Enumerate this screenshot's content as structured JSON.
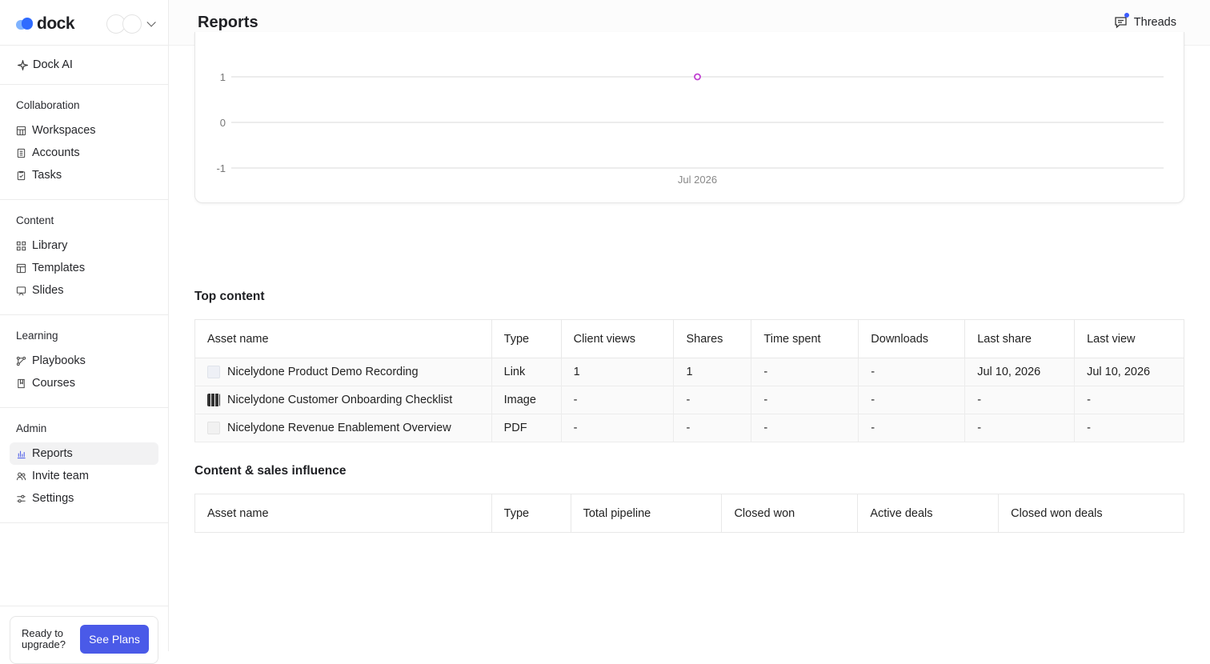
{
  "app": {
    "brand": "dock"
  },
  "header": {
    "title": "Reports",
    "threads_label": "Threads"
  },
  "sidebar": {
    "ai_label": "Dock AI",
    "sections": [
      {
        "title": "Collaboration",
        "items": [
          {
            "label": "Workspaces",
            "icon": "workspaces-icon"
          },
          {
            "label": "Accounts",
            "icon": "accounts-icon"
          },
          {
            "label": "Tasks",
            "icon": "tasks-icon"
          }
        ]
      },
      {
        "title": "Content",
        "items": [
          {
            "label": "Library",
            "icon": "library-icon"
          },
          {
            "label": "Templates",
            "icon": "templates-icon"
          },
          {
            "label": "Slides",
            "icon": "slides-icon"
          }
        ]
      },
      {
        "title": "Learning",
        "items": [
          {
            "label": "Playbooks",
            "icon": "playbooks-icon"
          },
          {
            "label": "Courses",
            "icon": "courses-icon"
          }
        ]
      },
      {
        "title": "Admin",
        "items": [
          {
            "label": "Reports",
            "icon": "reports-icon",
            "active": true
          },
          {
            "label": "Invite team",
            "icon": "invite-team-icon"
          },
          {
            "label": "Settings",
            "icon": "settings-icon"
          }
        ]
      }
    ],
    "upgrade": {
      "text": "Ready to upgrade?",
      "button": "See Plans"
    }
  },
  "chart_data": {
    "type": "line",
    "x": [
      "Jul 2026"
    ],
    "series": [
      {
        "values": [
          1
        ],
        "color": "#c03fd1"
      }
    ],
    "yticks": [
      "1",
      "0",
      "-1"
    ],
    "ylim": [
      -1,
      1
    ],
    "grid": true
  },
  "top_content": {
    "title": "Top content",
    "columns": [
      "Asset name",
      "Type",
      "Client views",
      "Shares",
      "Time spent",
      "Downloads",
      "Last share",
      "Last view"
    ],
    "rows": [
      {
        "thumb": "link",
        "name": "Nicelydone Product Demo Recording",
        "type": "Link",
        "client_views": "1",
        "shares": "1",
        "time_spent": "-",
        "downloads": "-",
        "last_share": "Jul 10, 2026",
        "last_view": "Jul 10, 2026"
      },
      {
        "thumb": "image",
        "name": "Nicelydone Customer Onboarding Checklist",
        "type": "Image",
        "client_views": "-",
        "shares": "-",
        "time_spent": "-",
        "downloads": "-",
        "last_share": "-",
        "last_view": "-"
      },
      {
        "thumb": "pdf",
        "name": "Nicelydone Revenue Enablement Overview",
        "type": "PDF",
        "client_views": "-",
        "shares": "-",
        "time_spent": "-",
        "downloads": "-",
        "last_share": "-",
        "last_view": "-"
      }
    ]
  },
  "influence": {
    "title": "Content & sales influence",
    "columns": [
      "Asset name",
      "Type",
      "Total pipeline",
      "Closed won",
      "Active deals",
      "Closed won deals"
    ]
  }
}
